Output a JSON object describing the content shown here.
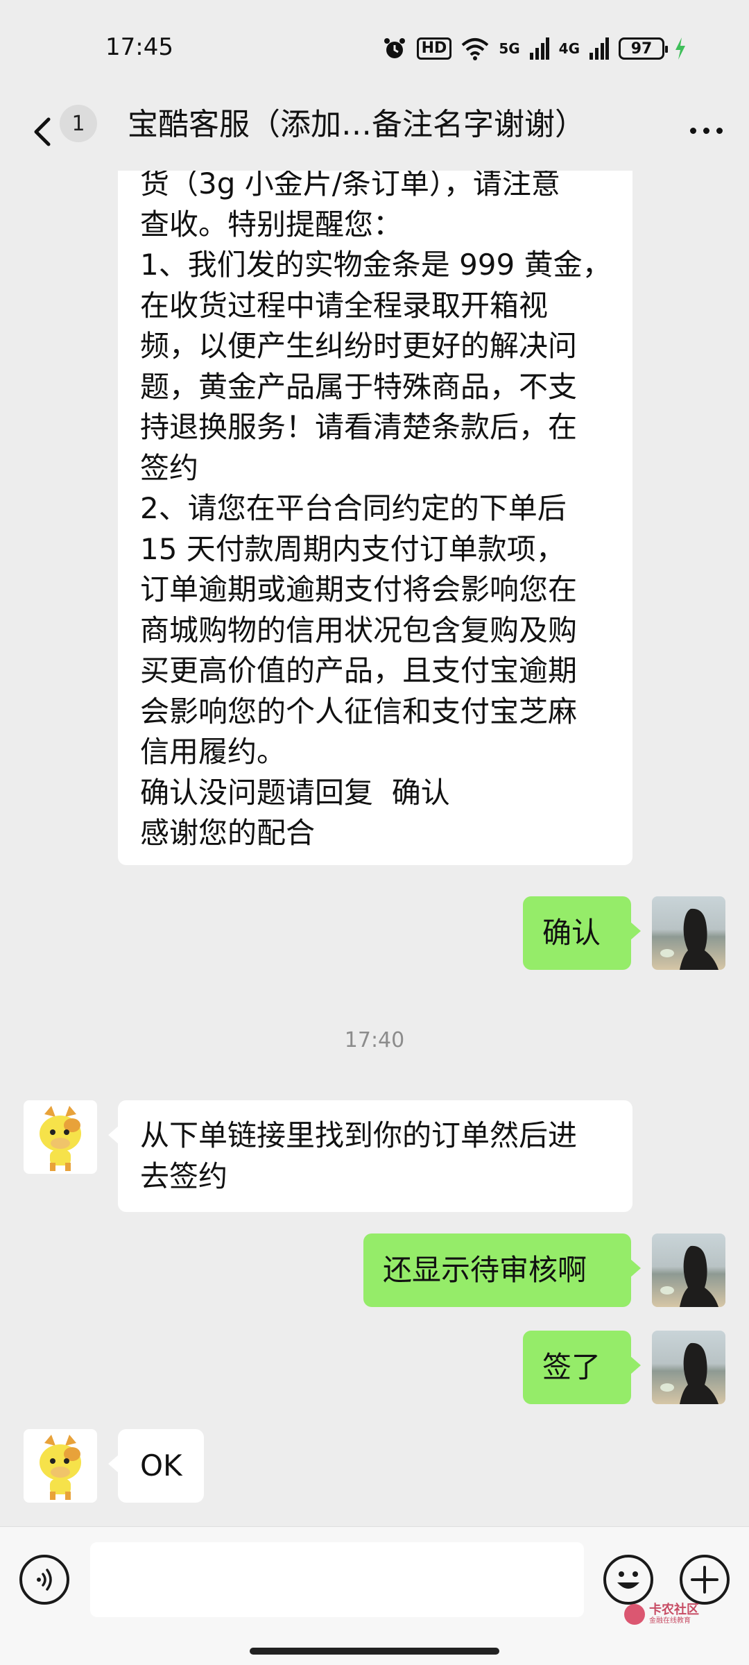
{
  "status_bar": {
    "time": "17:45",
    "icons": [
      "alarm-icon",
      "hd-icon",
      "wifi-icon",
      "5g-signal-icon",
      "4g-signal-icon",
      "battery-icon",
      "charging-icon"
    ],
    "hd_label": "HD",
    "net1": "5G",
    "net2": "4G",
    "battery": "97",
    "battery_color": "#111111",
    "charging_color": "#3fbf5a"
  },
  "header": {
    "back_icon": "chevron-left-icon",
    "unread_count": "1",
    "title": "宝酷客服（添加…备注名字谢谢）",
    "more_icon": "more-dots-icon"
  },
  "messages": [
    {
      "direction": "incoming",
      "text": "货（3g 小金片/条订单），请注意\n查收。特别提醒您：\n1、我们发的实物金条是 999 黄金，\n在收货过程中请全程录取开箱视\n频，以便产生纠纷时更好的解决问\n题，黄金产品属于特殊商品，不支\n持退换服务！请看清楚条款后，在\n签约\n2、请您在平台合同约定的下单后\n15 天付款周期内支付订单款项，\n订单逾期或逾期支付将会影响您在\n商城购物的信用状况包含复购及购\n买更高价值的产品，且支付宝逾期\n会影响您的个人征信和支付宝芝麻\n信用履约。\n确认没问题请回复  确认\n感谢您的配合"
    },
    {
      "direction": "outgoing",
      "text": "确认"
    },
    {
      "type": "timestamp",
      "text": "17:40"
    },
    {
      "direction": "incoming",
      "text": "从下单链接里找到你的订单然后进\n去签约"
    },
    {
      "direction": "outgoing",
      "text": "还显示待审核啊"
    },
    {
      "direction": "outgoing",
      "text": "签了"
    },
    {
      "direction": "incoming",
      "text": "OK"
    }
  ],
  "colors": {
    "background": "#ededed",
    "bubble_incoming": "#ffffff",
    "bubble_outgoing": "#95ec69",
    "timestamp": "#8c8c8c"
  },
  "input_bar": {
    "voice_icon": "voice-icon",
    "emoji_icon": "emoji-icon",
    "plus_icon": "plus-icon",
    "input_value": ""
  },
  "watermark": {
    "main": "卡农社区",
    "sub": "金融在线教育"
  }
}
